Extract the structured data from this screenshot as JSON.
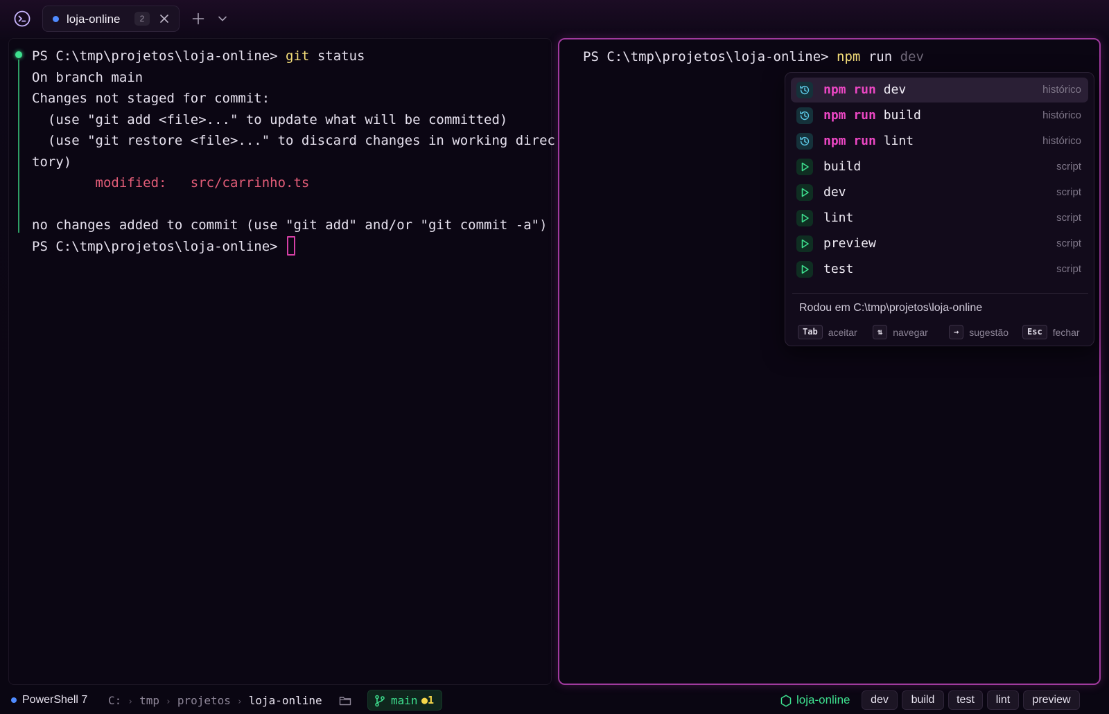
{
  "titlebar": {
    "tab": {
      "title": "loja-online",
      "count": "2"
    }
  },
  "left_pane": {
    "lines": [
      {
        "prompt": "PS C:\\tmp\\projetos\\loja-online> ",
        "cmd": "git",
        "arg": " status"
      },
      {
        "text": "On branch main"
      },
      {
        "text": "Changes not staged for commit:"
      },
      {
        "text": "  (use \"git add <file>...\" to update what will be committed)"
      },
      {
        "text": "  (use \"git restore <file>...\" to discard changes in working direc"
      },
      {
        "text": "tory)"
      },
      {
        "text": "        modified:   src/carrinho.ts"
      },
      {
        "text": ""
      },
      {
        "text": "no changes added to commit (use \"git add\" and/or \"git commit -a\")"
      },
      {
        "prompt": "PS C:\\tmp\\projetos\\loja-online> "
      }
    ]
  },
  "right_pane": {
    "prompt": "PS C:\\tmp\\projetos\\loja-online> ",
    "typed_cmd": "npm",
    "typed_arg": " run ",
    "ghost": "dev"
  },
  "autocomplete": {
    "items": [
      {
        "kw": "npm run",
        "rest": " dev",
        "kind": "histórico",
        "icon": "history-icon"
      },
      {
        "kw": "npm run",
        "rest": " build",
        "kind": "histórico",
        "icon": "history-icon"
      },
      {
        "kw": "npm run",
        "rest": " lint",
        "kind": "histórico",
        "icon": "history-icon"
      },
      {
        "kw": "",
        "rest": "build",
        "kind": "script",
        "icon": "play-icon"
      },
      {
        "kw": "",
        "rest": "dev",
        "kind": "script",
        "icon": "play-icon"
      },
      {
        "kw": "",
        "rest": "lint",
        "kind": "script",
        "icon": "play-icon"
      },
      {
        "kw": "",
        "rest": "preview",
        "kind": "script",
        "icon": "play-icon"
      },
      {
        "kw": "",
        "rest": "test",
        "kind": "script",
        "icon": "play-icon"
      }
    ],
    "footer": "Rodou em C:\\tmp\\projetos\\loja-online",
    "hints": [
      {
        "key": "Tab",
        "label": "aceitar"
      },
      {
        "key": "⇅",
        "label": "navegar"
      },
      {
        "key": "→",
        "label": "sugestão"
      },
      {
        "key": "Esc",
        "label": "fechar"
      }
    ]
  },
  "statusbar": {
    "shell": "PowerShell 7",
    "crumbs": [
      "C:",
      "tmp",
      "projetos",
      "loja-online"
    ],
    "branch": "main",
    "changes": "●1",
    "project": "loja-online",
    "scripts": [
      "dev",
      "build",
      "test",
      "lint",
      "preview"
    ]
  },
  "colors": {
    "accent": "#ec47c4",
    "git_green": "#3ee08f",
    "command_yellow": "#f6df7a",
    "modified_red": "#e35d78",
    "focus_border": "#a03a9e"
  }
}
